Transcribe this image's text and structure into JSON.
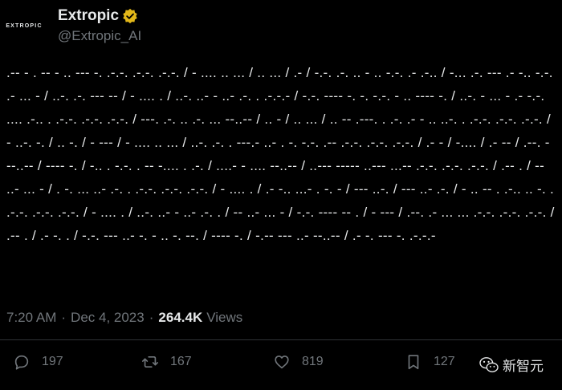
{
  "author": {
    "logo_text": "EXTROPIC",
    "display_name": "Extropic",
    "handle": "@Extropic_AI"
  },
  "tweet": {
    "text": ".-- - . -- - .. --- -. .-.-. .-.-. .-.-. / - .... .. ... / .. ... / .- / -.-. .-. .. - .. -.-. .- .-.. / -... .-. --- .- -.. -.-. .- ... - / ..-. .-. --- -- / - .... . / ..-. ..- - ..- .-. . .-.-.- / -.-. ---- -. -. -.-. - .. ---- -. / ..-. - ... - .- -.-. .... .-.. . .-.-. .-.-. .-.-. / ---. .-. .. .-. ... --..-- / .. - / .. ... / .. -- .---. . .-. .- - .. ..-. . .-.-. .-.-. .-.-. / - ..-. -. / .. -. / - --- / - .... .. ... / ..-. .-. . ---.- ..- . -. -.-. .-- .-.-. .-.-. .-.-. / .- - / -.... / .- -- / .--. - --..-- / ---- -. / -.. . -.-. . -- -.... . .-. / ....- - .... --..-- / ..--- ----- ..--- ...-- .-.-. .-.-. .-.-. / .-- . / -- ..- ... - / . -. ... ..- .-. . .-.-. .-.-. .-.-. / - .... . / .- -.. ...- . -. - / --- ..-. / --- ..- .-. / - .. -- . .-.. .. -. . .-.-. .-.-. .-.-. / - .... . / ..-. ..- - ..- .-. . / -- ..- ... - / -.-. ---- -- . / - --- / .--. .- ... ... .-.-. .-.-. .-.-. / .-- . / .- -. . / -.-. --- ..- -. - .. -. --. / ---- -. / -.-- --- ..- --..-- / .- -. --- -. .-.-.-"
  },
  "meta": {
    "time": "7:20 AM",
    "separator": "·",
    "date": "Dec 4, 2023",
    "views_count": "264.4K",
    "views_label": "Views"
  },
  "actions": {
    "replies": "197",
    "reposts": "167",
    "likes": "819",
    "bookmarks": "127"
  },
  "watermark": {
    "text": "新智元"
  },
  "colors": {
    "background": "#000000",
    "text": "#e7e9ea",
    "secondary": "#71767b",
    "verified_gold": "#e2b719"
  }
}
